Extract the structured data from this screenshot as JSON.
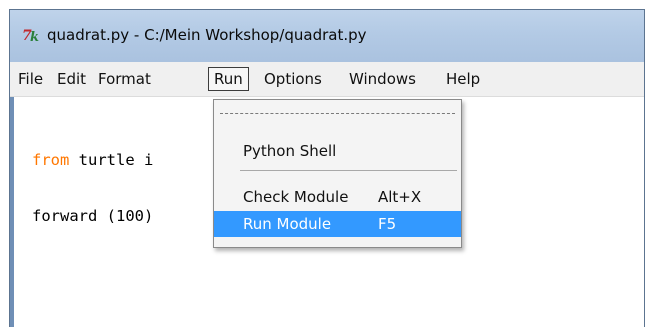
{
  "window": {
    "title": "quadrat.py - C:/Mein Workshop/quadrat.py",
    "icon": "idle-logo-icon"
  },
  "menubar": {
    "items": [
      "File",
      "Edit",
      "Format",
      "Run",
      "Options",
      "Windows",
      "Help"
    ],
    "active": "Run"
  },
  "editor": {
    "lines": [
      {
        "keyword": "from",
        "rest": " turtle i"
      },
      {
        "keyword": "",
        "rest": "forward (100)"
      }
    ]
  },
  "run_menu": {
    "python_shell": "Python Shell",
    "check_module": "Check Module",
    "check_module_accel": "Alt+X",
    "run_module": "Run Module",
    "run_module_accel": "F5"
  },
  "colors": {
    "keyword": "#ff7700",
    "highlight": "#3399ff",
    "titlebar": "#b3cae5"
  }
}
